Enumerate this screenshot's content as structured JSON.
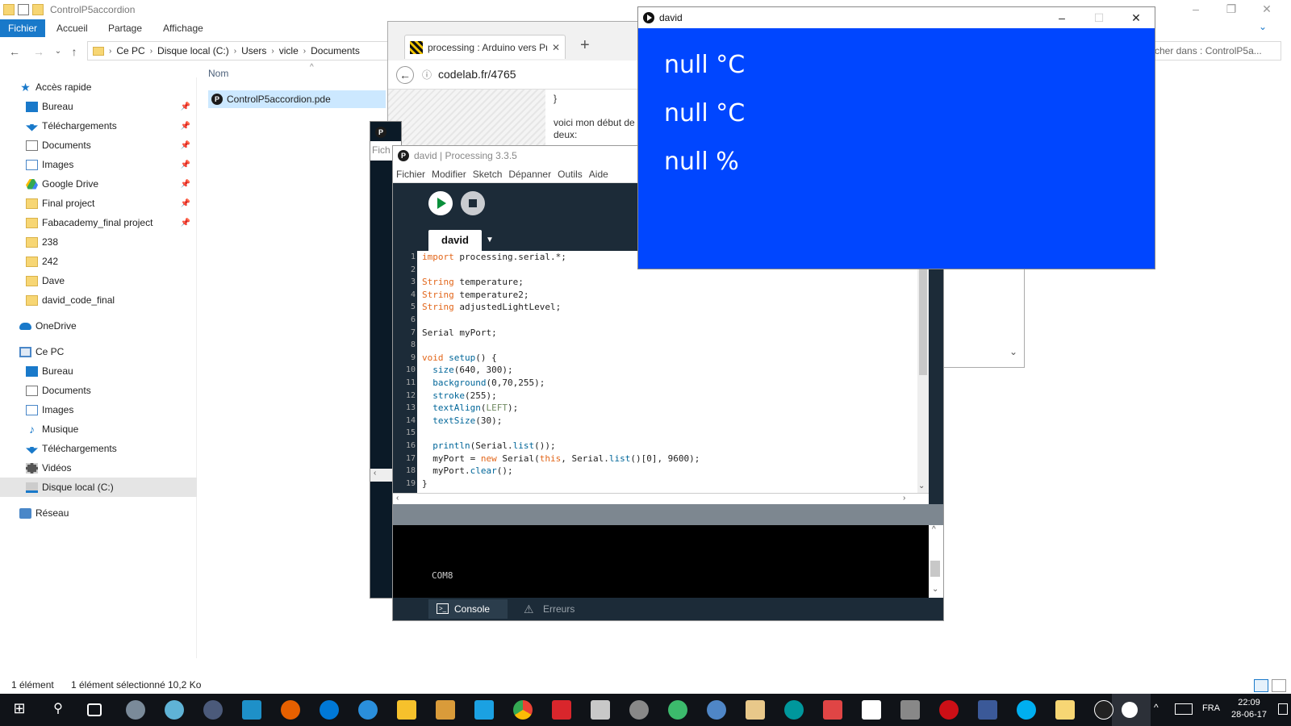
{
  "explorer": {
    "title": "ControlP5accordion",
    "ribbon_tabs": {
      "file": "Fichier",
      "home": "Accueil",
      "share": "Partage",
      "view": "Affichage"
    },
    "breadcrumb": [
      "Ce PC",
      "Disque local (C:)",
      "Users",
      "vicle",
      "Documents"
    ],
    "search_placeholder": "cher dans : ControlP5a...",
    "sidebar": {
      "quick_access": "Accès rapide",
      "pinned": [
        "Bureau",
        "Téléchargements",
        "Documents",
        "Images",
        "Google Drive",
        "Final project",
        "Fabacademy_final project"
      ],
      "recent": [
        "238",
        "242",
        "Dave",
        "david_code_final"
      ],
      "onedrive": "OneDrive",
      "this_pc": "Ce PC",
      "pc_items": [
        "Bureau",
        "Documents",
        "Images",
        "Musique",
        "Téléchargements",
        "Vidéos",
        "Disque local (C:)"
      ],
      "network": "Réseau"
    },
    "column_header": "Nom",
    "file": "ControlP5accordion.pde",
    "status": {
      "count": "1 élément",
      "selected": "1 élément sélectionné",
      "size": "10,2 Ko"
    }
  },
  "browser": {
    "tab_title": "processing : Arduino vers Pr",
    "url": "codelab.fr/4765",
    "content_brace": "}",
    "content_text": "voici mon début de les deux:"
  },
  "back_window": {
    "menu_fragment": "Fich"
  },
  "ide": {
    "title": "david | Processing 3.3.5",
    "menu": [
      "Fichier",
      "Modifier",
      "Sketch",
      "Dépanner",
      "Outils",
      "Aide"
    ],
    "tab": "david",
    "code_lines": [
      "import processing.serial.*;",
      "",
      "String temperature;",
      "String temperature2;",
      "String adjustedLightLevel;",
      "",
      "Serial myPort;",
      "",
      "void setup() {",
      "  size(640, 300);",
      "  background(0,70,255);",
      "  stroke(255);",
      "  textAlign(LEFT);",
      "  textSize(30);",
      "",
      "  println(Serial.list());",
      "  myPort = new Serial(this, Serial.list()[0], 9600);",
      "  myPort.clear();",
      "}"
    ],
    "console_output": "COM8",
    "footer_tabs": {
      "console": "Console",
      "errors": "Erreurs"
    }
  },
  "sketch": {
    "title": "david",
    "values": [
      "null °C",
      "null °C",
      "null %"
    ],
    "background_color": "#0046ff"
  },
  "taskbar": {
    "language": "FRA",
    "time": "22:09",
    "date": "28-06-17"
  }
}
